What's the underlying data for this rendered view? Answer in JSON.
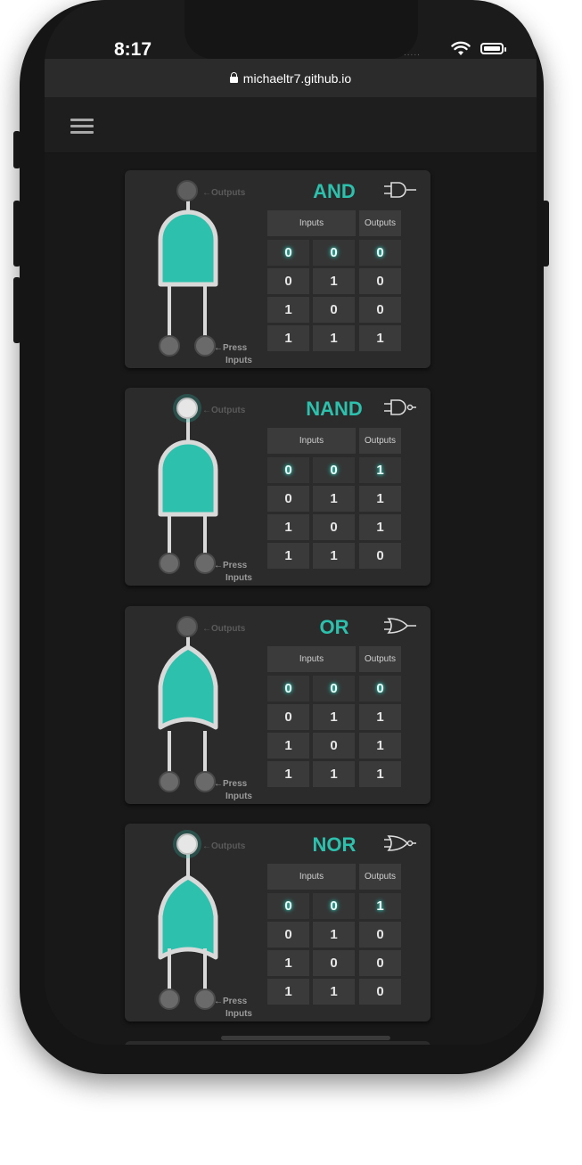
{
  "status_bar": {
    "time": "8:17",
    "signal": "....."
  },
  "browser": {
    "url": "michaeltr7.github.io"
  },
  "colors": {
    "accent": "#2cc0ad",
    "card": "#2b2b2b",
    "background": "#181818"
  },
  "labels": {
    "outputs": "←Outputs",
    "press": "←Press",
    "inputs_word": "Inputs",
    "inputs_header": "Inputs",
    "outputs_header": "Outputs"
  },
  "gates": [
    {
      "name": "AND",
      "icon": "and-gate-icon",
      "output_lit": false,
      "rows": [
        [
          "0",
          "0",
          "0"
        ],
        [
          "0",
          "1",
          "0"
        ],
        [
          "1",
          "0",
          "0"
        ],
        [
          "1",
          "1",
          "1"
        ]
      ]
    },
    {
      "name": "NAND",
      "icon": "nand-gate-icon",
      "output_lit": true,
      "rows": [
        [
          "0",
          "0",
          "1"
        ],
        [
          "0",
          "1",
          "1"
        ],
        [
          "1",
          "0",
          "1"
        ],
        [
          "1",
          "1",
          "0"
        ]
      ]
    },
    {
      "name": "OR",
      "icon": "or-gate-icon",
      "output_lit": false,
      "rows": [
        [
          "0",
          "0",
          "0"
        ],
        [
          "0",
          "1",
          "1"
        ],
        [
          "1",
          "0",
          "1"
        ],
        [
          "1",
          "1",
          "1"
        ]
      ]
    },
    {
      "name": "NOR",
      "icon": "nor-gate-icon",
      "output_lit": true,
      "rows": [
        [
          "0",
          "0",
          "1"
        ],
        [
          "0",
          "1",
          "0"
        ],
        [
          "1",
          "0",
          "0"
        ],
        [
          "1",
          "1",
          "0"
        ]
      ]
    }
  ]
}
